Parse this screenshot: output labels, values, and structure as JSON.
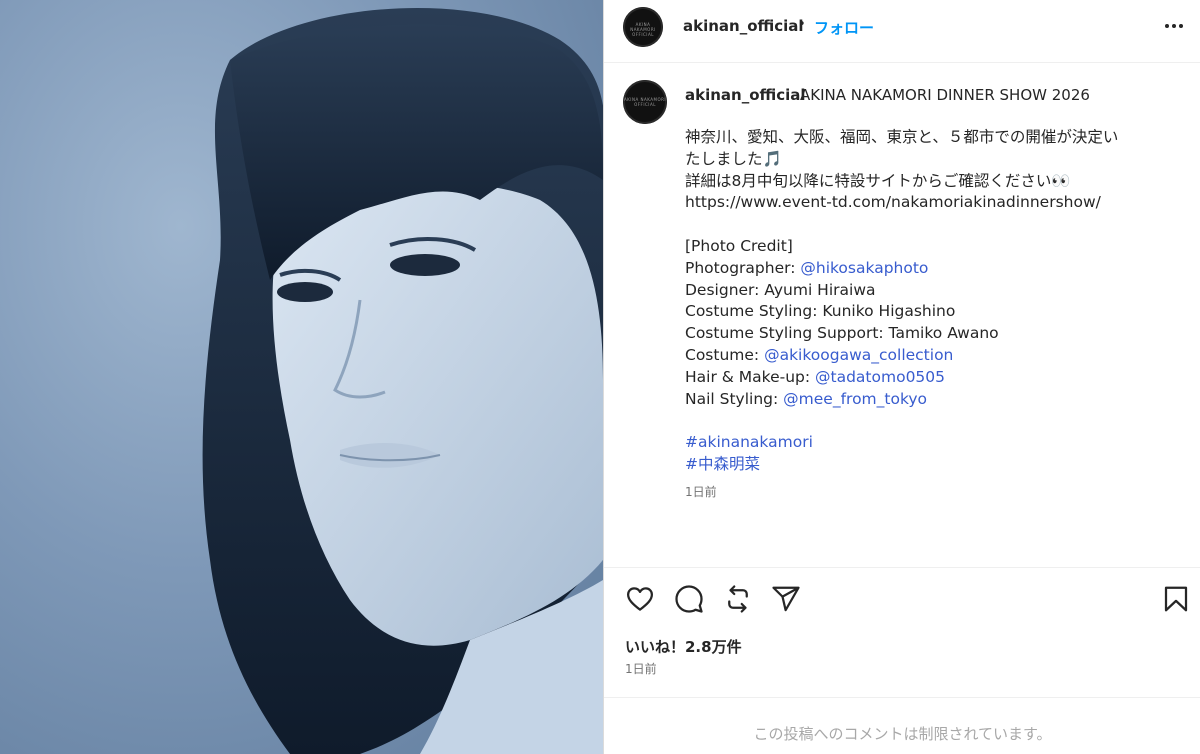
{
  "post": {
    "image_alt": "akinan_official post photo",
    "username": "akinan_official",
    "avatar_text": "AKINA NAKAMORI OFFICIAL"
  },
  "header": {
    "separator": "•",
    "follow_label": "フォロー"
  },
  "caption": {
    "title": "AKINA NAKAMORI DINNER SHOW 2026",
    "lines": [
      {
        "text": "神奈川、愛知、大阪、福岡、東京と、５都市での開催が決定い"
      },
      {
        "text": "たしました🎵"
      },
      {
        "text": "詳細は8月中旬以降に特設サイトからご確認ください👀"
      },
      {
        "text": "https://www.event-td.com/nakamoriakinadinnershow/"
      },
      {
        "text": ""
      },
      {
        "text": "[Photo Credit]"
      },
      {
        "label": "Photographer: ",
        "mention": "@hikosakaphoto"
      },
      {
        "text": "Designer: Ayumi Hiraiwa"
      },
      {
        "text": "Costume Styling: Kuniko Higashino"
      },
      {
        "text": "Costume Styling Support: Tamiko Awano"
      },
      {
        "label": "Costume: ",
        "mention": "@akikoogawa_collection"
      },
      {
        "label": "Hair & Make-up: ",
        "mention": "@tadatomo0505"
      },
      {
        "label": "Nail Styling: ",
        "mention": "@mee_from_tokyo"
      },
      {
        "text": ""
      },
      {
        "tag": "#akinanakamori"
      },
      {
        "tag": "#中森明菜"
      }
    ],
    "time": "1日前"
  },
  "actions": {
    "likes": "いいね！2.8万件",
    "date": "1日前"
  },
  "footer": {
    "comments_restricted": "この投稿へのコメントは制限されています。"
  },
  "colors": {
    "accent": "#0095f6",
    "link": "#385cce",
    "text": "#262626",
    "muted": "#737373",
    "photo_tint": "#7f99b8"
  }
}
